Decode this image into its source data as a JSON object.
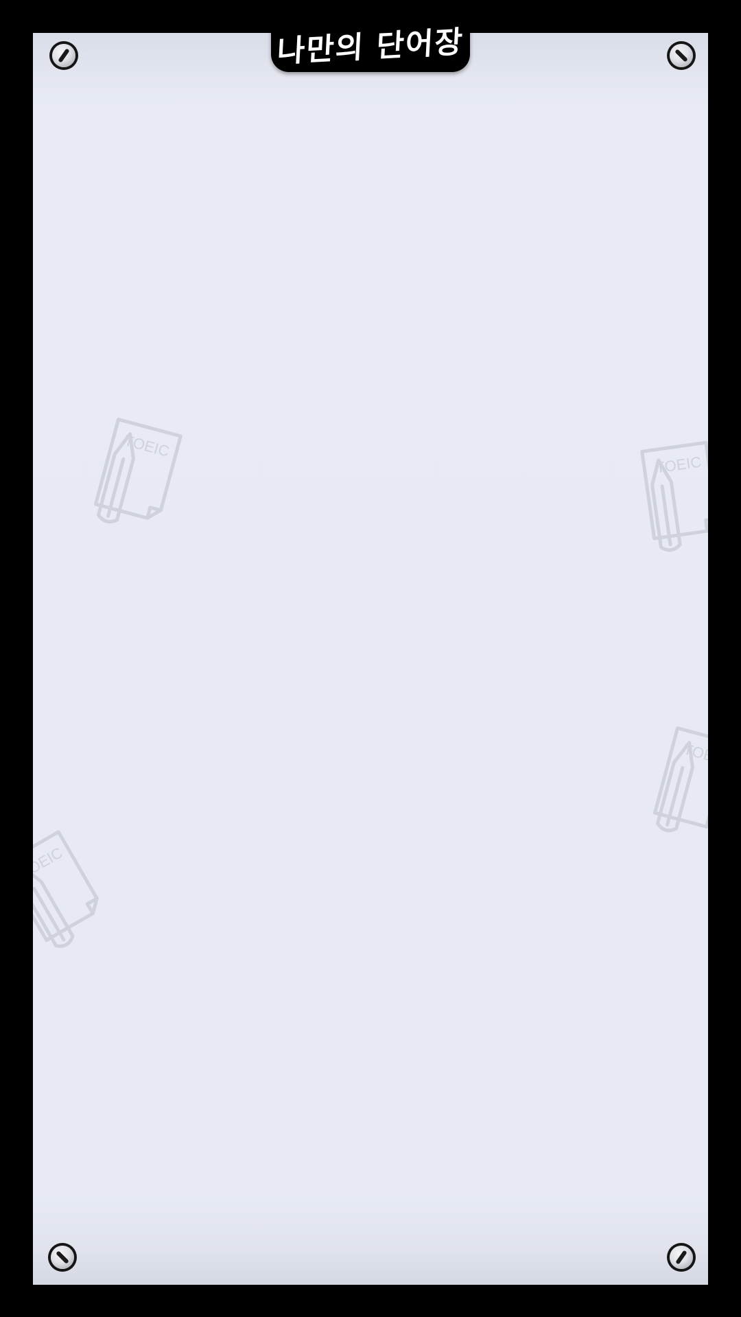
{
  "app": {
    "title": "나만의 단어장"
  },
  "background": {
    "watermark_label": "TOEIC",
    "watermark_icon": "toeic-notebook-pencil-icon"
  },
  "colors": {
    "frame": "#000000",
    "panel": "#e8ebf3",
    "watermark": "#cfd2da",
    "title_text": "#ffffff"
  }
}
